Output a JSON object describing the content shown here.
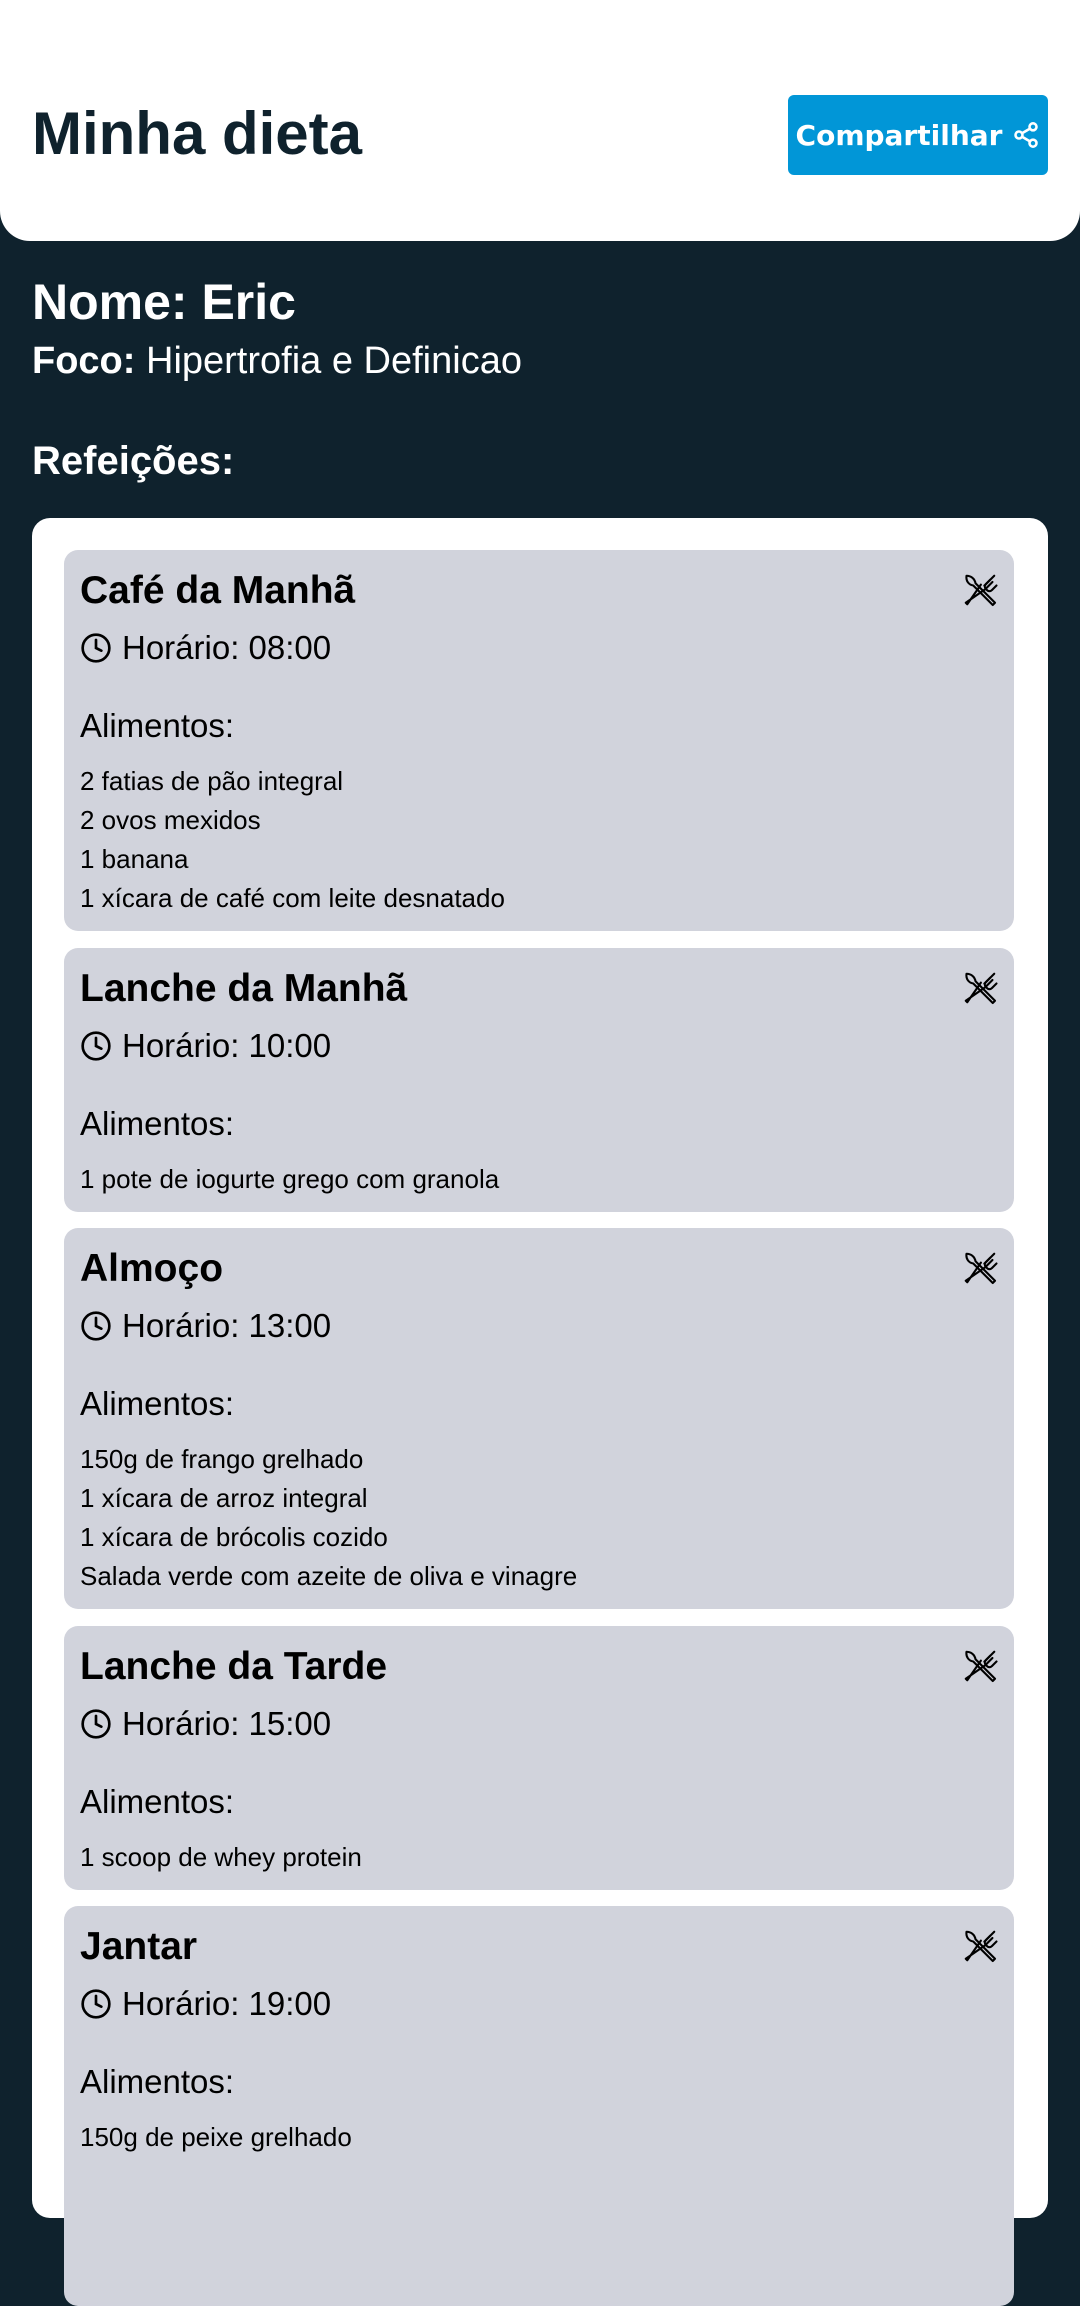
{
  "header": {
    "title": "Minha dieta",
    "share_label": "Compartilhar"
  },
  "profile": {
    "name_line": "Nome: Eric",
    "focus_label": "Foco:",
    "focus_value": "Hipertrofia e Definicao"
  },
  "meals_heading": "Refeições:",
  "meals": [
    {
      "name": "Café da Manhã",
      "time": "Horário: 08:00",
      "foods_label": "Alimentos:",
      "foods": [
        "2 fatias de pão integral",
        "2 ovos mexidos",
        "1 banana",
        "1 xícara de café com leite desnatado"
      ]
    },
    {
      "name": "Lanche da Manhã",
      "time": "Horário: 10:00",
      "foods_label": "Alimentos:",
      "foods": [
        "1 pote de iogurte grego com granola"
      ]
    },
    {
      "name": "Almoço",
      "time": "Horário: 13:00",
      "foods_label": "Alimentos:",
      "foods": [
        "150g de frango grelhado",
        "1 xícara de arroz integral",
        "1 xícara de brócolis cozido",
        "Salada verde com azeite de oliva e vinagre"
      ]
    },
    {
      "name": "Lanche da Tarde",
      "time": "Horário: 15:00",
      "foods_label": "Alimentos:",
      "foods": [
        "1 scoop de whey protein"
      ]
    },
    {
      "name": "Jantar",
      "time": "Horário: 19:00",
      "foods_label": "Alimentos:",
      "foods": [
        "150g de peixe grelhado"
      ]
    }
  ],
  "colors": {
    "background": "#0f222d",
    "accent": "#0196d7",
    "card": "#d1d3dc"
  },
  "icons": {
    "share": "share-icon",
    "clock": "clock-icon",
    "meal": "cutlery-icon"
  }
}
